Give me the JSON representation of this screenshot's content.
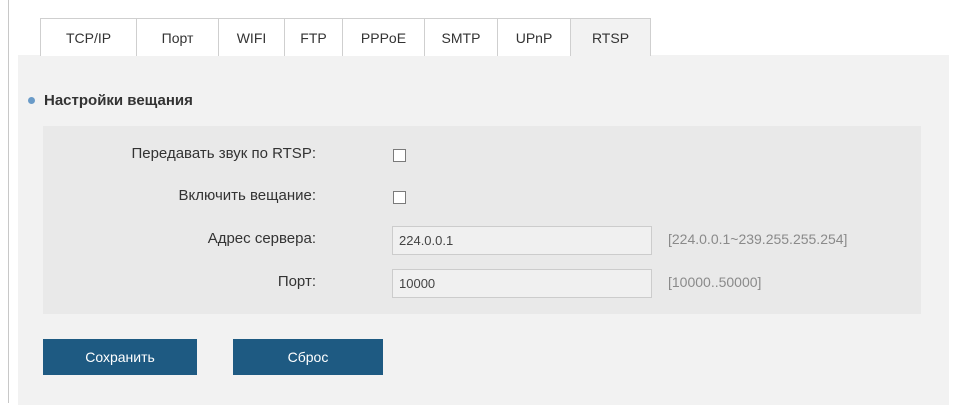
{
  "tabs": [
    {
      "label": "TCP/IP",
      "active": false
    },
    {
      "label": "Порт",
      "active": false
    },
    {
      "label": "WIFI",
      "active": false
    },
    {
      "label": "FTP",
      "active": false
    },
    {
      "label": "PPPoE",
      "active": false
    },
    {
      "label": "SMTP",
      "active": false
    },
    {
      "label": "UPnP",
      "active": false
    },
    {
      "label": "RTSP",
      "active": true
    }
  ],
  "section": {
    "title": "Настройки вещания"
  },
  "form": {
    "audio_rtsp": {
      "label": "Передавать звук по RTSP:",
      "checked": false
    },
    "enable_broadcast": {
      "label": "Включить вещание:",
      "checked": false
    },
    "server_address": {
      "label": "Адрес сервера:",
      "value": "224.0.0.1",
      "hint": "[224.0.0.1~239.255.255.254]"
    },
    "port": {
      "label": "Порт:",
      "value": "10000",
      "hint": "[10000..50000]"
    }
  },
  "buttons": {
    "save_label": "Сохранить",
    "reset_label": "Сброс"
  },
  "colors": {
    "button_bg": "#1e5a82",
    "bullet": "#6a9bc8",
    "content_bg": "#f2f2f2",
    "panel_bg": "#e9e9e9"
  }
}
